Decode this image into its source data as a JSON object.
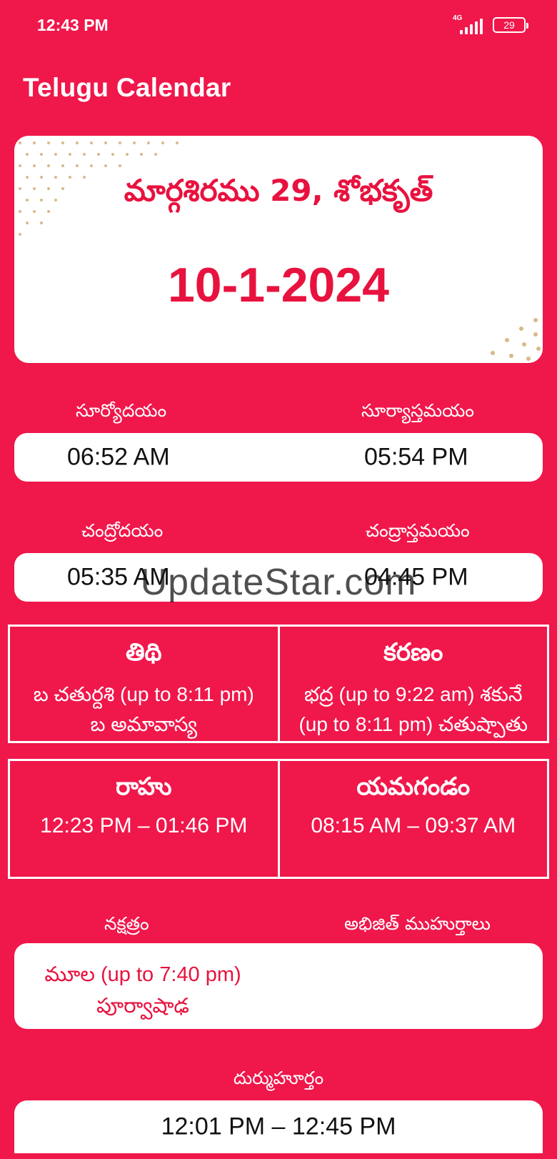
{
  "status_bar": {
    "time": "12:43 PM",
    "network": "4G",
    "battery": "29"
  },
  "app_bar": {
    "title": "Telugu Calendar"
  },
  "date_card": {
    "telugu_date": "మార్గశిరము 29, శోభకృత్",
    "gregorian_date": "10-1-2024"
  },
  "sun": {
    "rise_label": "సూర్యోదయం",
    "set_label": "సూర్యాస్తమయం",
    "rise": "06:52 AM",
    "set": "05:54 PM"
  },
  "moon": {
    "rise_label": "చంద్రోదయం",
    "set_label": "చంద్రాస్తమయం",
    "rise": "05:35 AM",
    "set": "04:45 PM"
  },
  "tithi": {
    "title": "తిథి",
    "line1": "బ చతుర్దశి (up to 8:11 pm)",
    "line2": "బ అమావాస్య"
  },
  "karanam": {
    "title": "కరణం",
    "line1": "భద్ర (up to 9:22 am) శకునే",
    "line2": "(up to 8:11 pm) చతుష్పాతు"
  },
  "rahu": {
    "title": "రాహు",
    "time": "12:23 PM – 01:46 PM"
  },
  "yamagandam": {
    "title": "యమగండం",
    "time": "08:15 AM – 09:37 AM"
  },
  "nakshatram": {
    "label": "నక్షత్రం",
    "value": "మూల (up to 7:40 pm) పూర్వాషాఢ"
  },
  "abhijit": {
    "label": "అభిజిత్ ముహుర్తాలు"
  },
  "durmuhurtham": {
    "label": "దుర్ముహూర్తం",
    "value": "12:01 PM – 12:45 PM"
  },
  "watermark": "UpdateStar.com",
  "colors": {
    "primary": "#f0174b",
    "accent_text": "#e8123f",
    "card": "#ffffff"
  }
}
